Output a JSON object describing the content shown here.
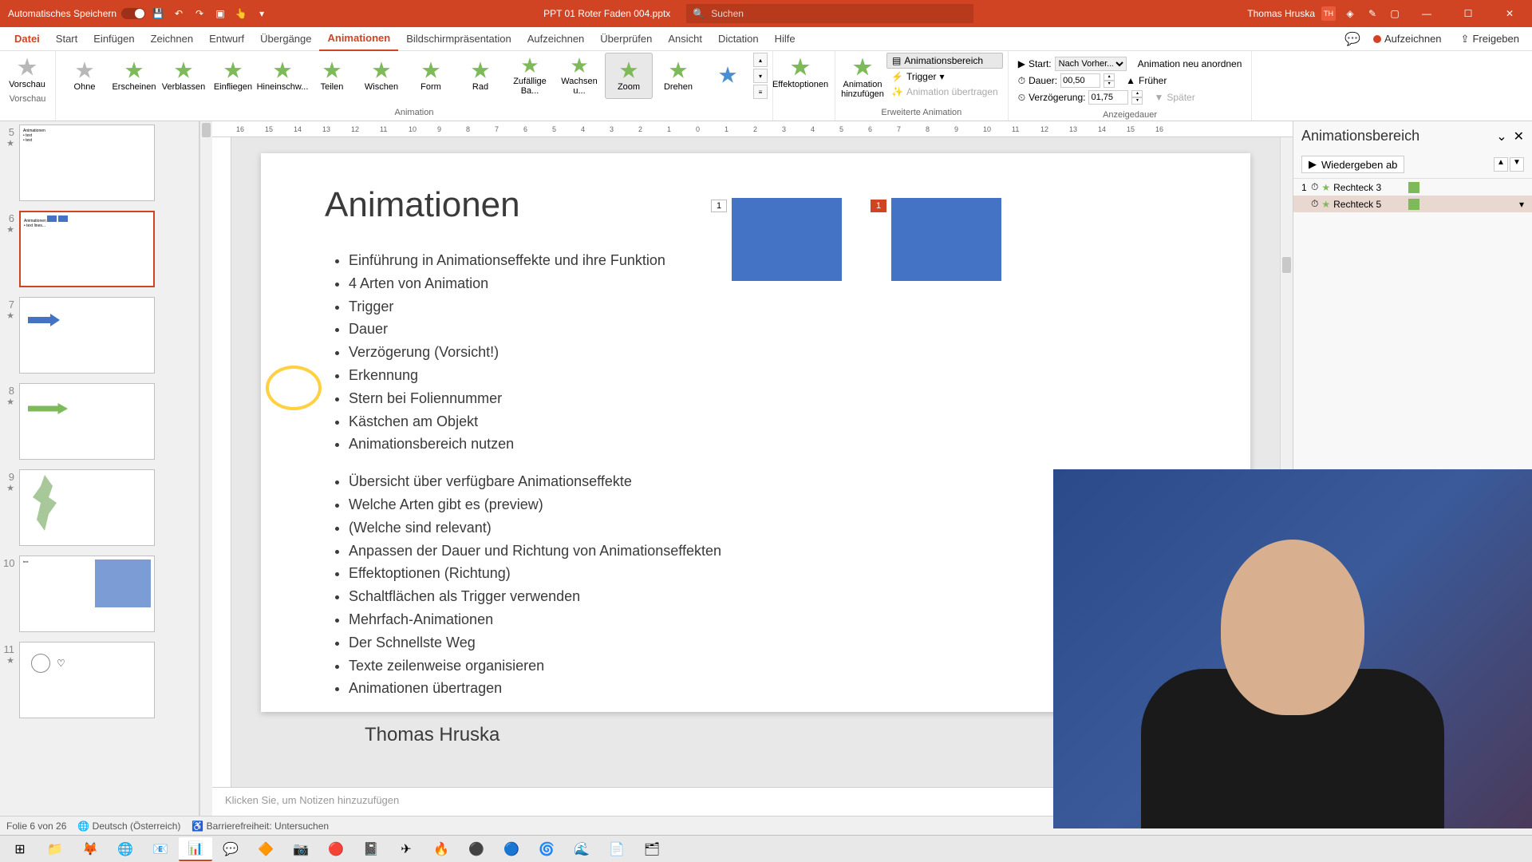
{
  "title_bar": {
    "autosave_label": "Automatisches Speichern",
    "filename": "PPT 01 Roter Faden 004.pptx",
    "search_placeholder": "Suchen",
    "username": "Thomas Hruska",
    "user_initials": "TH"
  },
  "tabs": {
    "file": "Datei",
    "items": [
      "Start",
      "Einfügen",
      "Zeichnen",
      "Entwurf",
      "Übergänge",
      "Animationen",
      "Bildschirmpräsentation",
      "Aufzeichnen",
      "Überprüfen",
      "Ansicht",
      "Dictation",
      "Hilfe"
    ],
    "active": "Animationen",
    "record": "Aufzeichnen",
    "share": "Freigeben"
  },
  "ribbon": {
    "preview": "Vorschau",
    "preview_group": "Vorschau",
    "animations": [
      "Ohne",
      "Erscheinen",
      "Verblassen",
      "Einfliegen",
      "Hineinschw...",
      "Teilen",
      "Wischen",
      "Form",
      "Rad",
      "Zufällige Ba...",
      "Wachsen u...",
      "Zoom",
      "Drehen"
    ],
    "selected_anim": "Zoom",
    "animation_group": "Animation",
    "effect_options": "Effektoptionen",
    "add_animation": "Animation hinzufügen",
    "anim_pane_btn": "Animationsbereich",
    "trigger": "Trigger",
    "anim_painter": "Animation übertragen",
    "advanced_group": "Erweiterte Animation",
    "start_label": "Start:",
    "start_value": "Nach Vorher...",
    "duration_label": "Dauer:",
    "duration_value": "00,50",
    "delay_label": "Verzögerung:",
    "delay_value": "01,75",
    "reorder_label": "Animation neu anordnen",
    "earlier": "Früher",
    "later": "Später",
    "timing_group": "Anzeigedauer"
  },
  "thumbnails": [
    {
      "num": "5",
      "star": "★"
    },
    {
      "num": "6",
      "star": "★",
      "active": true
    },
    {
      "num": "7",
      "star": "★"
    },
    {
      "num": "8",
      "star": "★"
    },
    {
      "num": "9",
      "star": "★"
    },
    {
      "num": "10",
      "star": ""
    },
    {
      "num": "11",
      "star": "★"
    }
  ],
  "slide": {
    "title": "Animationen",
    "bullets": [
      "Einführung in Animationseffekte und ihre Funktion",
      "4 Arten von Animation",
      "Trigger",
      "Dauer",
      "Verzögerung (Vorsicht!)",
      "Erkennung",
      "Stern bei Foliennummer",
      "Kästchen am Objekt",
      "Animationsbereich nutzen",
      "Übersicht über verfügbare Animationseffekte",
      "Welche Arten gibt es (preview)",
      "(Welche sind relevant)",
      "Anpassen der Dauer und Richtung von Animationseffekten",
      "Effektoptionen (Richtung)",
      "Schaltflächen als Trigger verwenden",
      "Mehrfach-Animationen",
      "Der Schnellste Weg",
      "Texte zeilenweise organisieren",
      "Animationen übertragen"
    ],
    "presenter": "Thomas Hruska",
    "tag1": "1",
    "tag2": "1"
  },
  "notes_placeholder": "Klicken Sie, um Notizen hinzuzufügen",
  "anim_pane": {
    "title": "Animationsbereich",
    "play": "Wiedergeben ab",
    "items": [
      {
        "num": "1",
        "name": "Rechteck 3"
      },
      {
        "num": "",
        "name": "Rechteck 5",
        "selected": true
      }
    ]
  },
  "status": {
    "slide_info": "Folie 6 von 26",
    "language": "Deutsch (Österreich)",
    "accessibility": "Barrierefreiheit: Untersuchen"
  },
  "ruler_marks": [
    "16",
    "15",
    "14",
    "13",
    "12",
    "11",
    "10",
    "9",
    "8",
    "7",
    "6",
    "5",
    "4",
    "3",
    "2",
    "1",
    "0",
    "1",
    "2",
    "3",
    "4",
    "5",
    "6",
    "7",
    "8",
    "9",
    "10",
    "11",
    "12",
    "13",
    "14",
    "15",
    "16"
  ]
}
